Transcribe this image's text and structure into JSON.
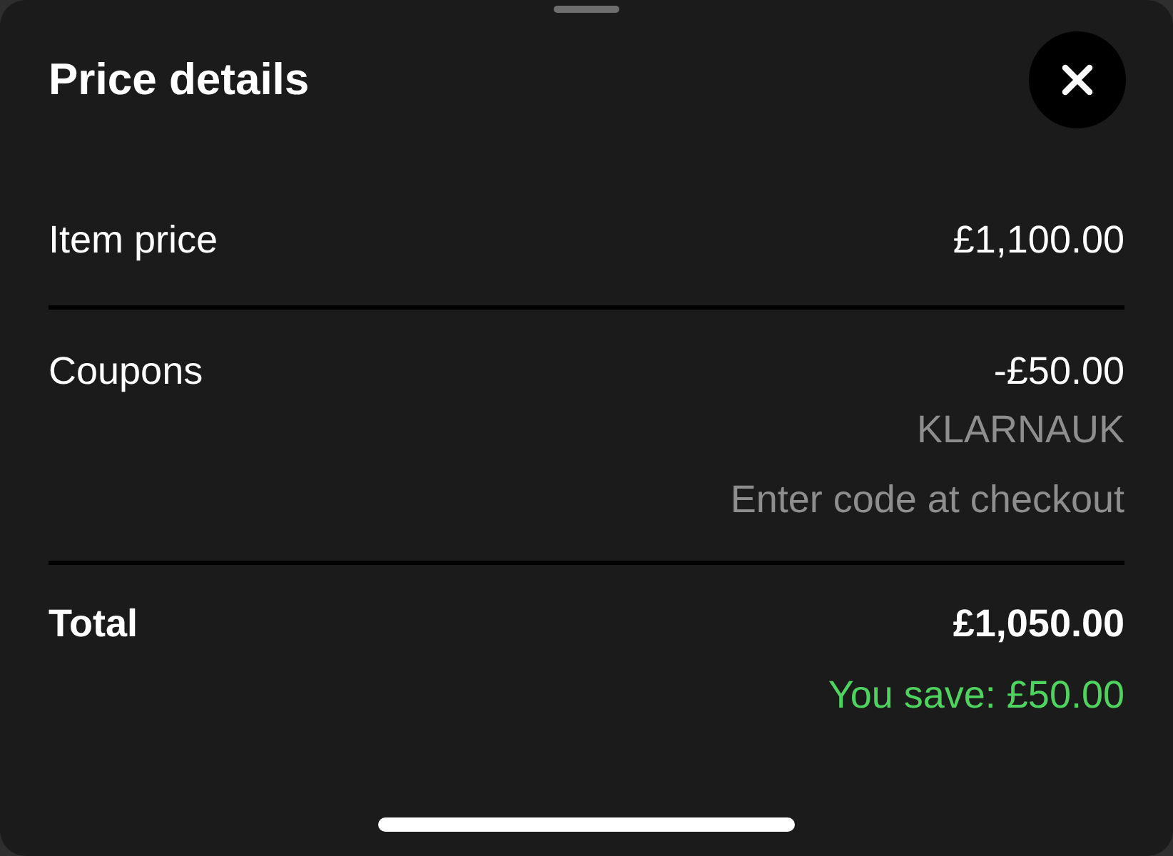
{
  "sheet": {
    "title": "Price details"
  },
  "rows": [
    {
      "kind": "line",
      "label": "Item price",
      "value": "£1,100.00"
    },
    {
      "kind": "line",
      "label": "Coupons",
      "value": "-£50.00",
      "code": "KLARNAUK",
      "hint": "Enter code at checkout"
    },
    {
      "kind": "total",
      "label": "Total",
      "value": "£1,050.00",
      "savings": "You save: £50.00"
    }
  ]
}
